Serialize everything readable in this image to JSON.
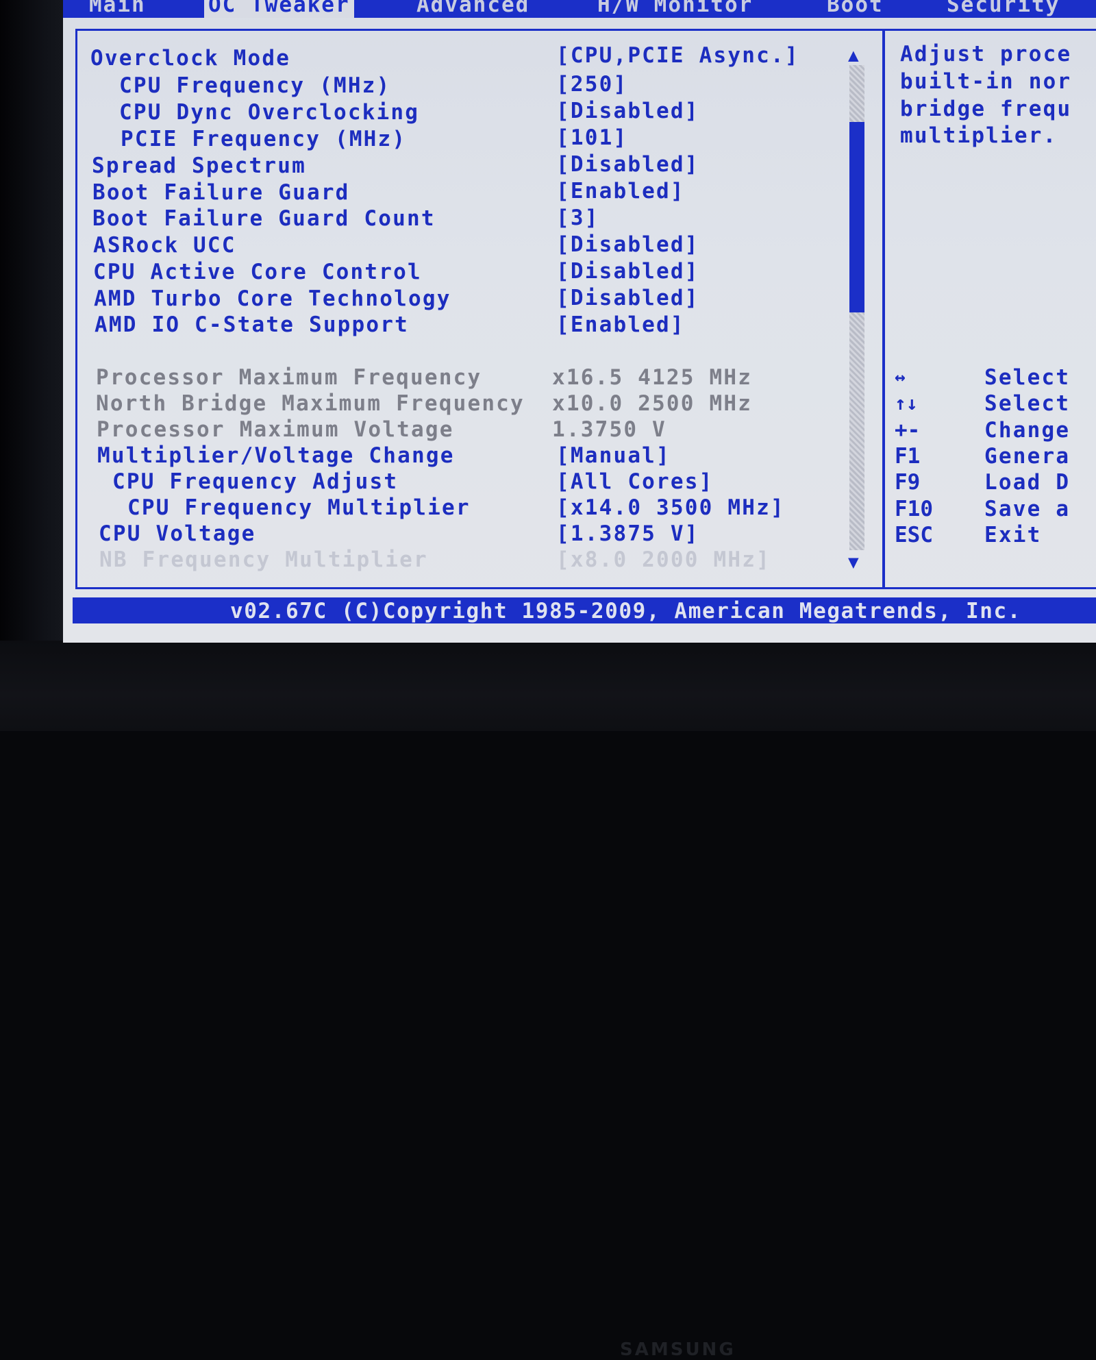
{
  "tabs": [
    {
      "label": "Main",
      "active": false
    },
    {
      "label": "OC Tweaker",
      "active": true
    },
    {
      "label": "Advanced",
      "active": false
    },
    {
      "label": "H/W Monitor",
      "active": false
    },
    {
      "label": "Boot",
      "active": false
    },
    {
      "label": "Security",
      "active": false
    }
  ],
  "settings": [
    {
      "label": "Overclock Mode",
      "value": "[CPU,PCIE Async.]"
    },
    {
      "label": "CPU Frequency (MHz)",
      "value": "[250]"
    },
    {
      "label": "CPU Dync Overclocking",
      "value": "[Disabled]"
    },
    {
      "label": "PCIE Frequency (MHz)",
      "value": "[101]"
    },
    {
      "label": "Spread Spectrum",
      "value": "[Disabled]"
    },
    {
      "label": "Boot Failure Guard",
      "value": "[Enabled]"
    },
    {
      "label": "Boot Failure Guard Count",
      "value": "[3]"
    },
    {
      "label": "ASRock UCC",
      "value": "[Disabled]"
    },
    {
      "label": "CPU Active Core Control",
      "value": "[Disabled]"
    },
    {
      "label": "AMD Turbo Core Technology",
      "value": "[Disabled]"
    },
    {
      "label": "AMD IO C-State Support",
      "value": "[Enabled]"
    }
  ],
  "info": [
    {
      "label": "Processor Maximum Frequency",
      "value": "x16.5 4125 MHz"
    },
    {
      "label": "North Bridge Maximum Frequency",
      "value": "x10.0 2500 MHz"
    },
    {
      "label": "Processor Maximum Voltage",
      "value": "1.3750 V"
    }
  ],
  "settings2": [
    {
      "label": "Multiplier/Voltage Change",
      "value": "[Manual]"
    },
    {
      "label": "CPU Frequency Adjust",
      "value": "[All Cores]"
    },
    {
      "label": "CPU Frequency Multiplier",
      "value": "[x14.0 3500 MHz]"
    },
    {
      "label": "CPU Voltage",
      "value": "[1.3875 V]"
    },
    {
      "label": "NB Frequency Multiplier",
      "value": "[x8.0  2000 MHz]"
    }
  ],
  "help": {
    "lines": [
      "Adjust proce",
      "built-in nor",
      "bridge frequ",
      "multiplier."
    ],
    "keys": [
      {
        "key": "↔",
        "desc": "Select"
      },
      {
        "key": "↑↓",
        "desc": "Select"
      },
      {
        "key": "+-",
        "desc": "Change"
      },
      {
        "key": "F1",
        "desc": "Genera"
      },
      {
        "key": "F9",
        "desc": "Load D"
      },
      {
        "key": "F10",
        "desc": "Save a"
      },
      {
        "key": "ESC",
        "desc": "Exit"
      }
    ]
  },
  "scroll": {
    "up": "▲",
    "down": "▼"
  },
  "footer": "v02.67C (C)Copyright 1985-2009, American Megatrends, Inc.",
  "monitor_brand": "SAMSUNG",
  "colors": {
    "accent": "#1b2fc8",
    "background": "#dfe3ea",
    "info_text": "#7d7f8a"
  }
}
